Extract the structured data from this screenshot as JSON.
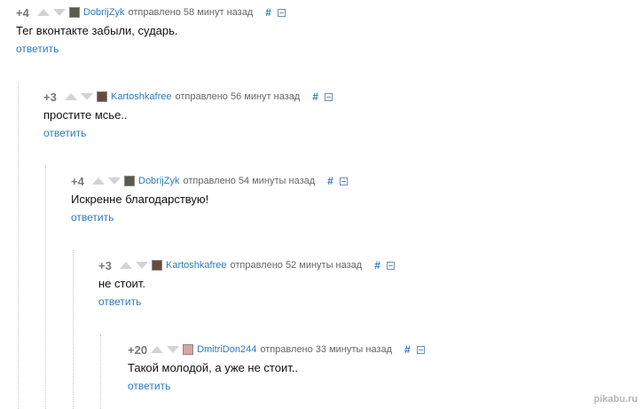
{
  "comments": [
    {
      "rating": "+4",
      "author": "DobrijZyk",
      "sent": "отправлено 58 минут назад",
      "hash": "#",
      "text": "Тег вконтакте забыли, сударь.",
      "reply": "ответить"
    },
    {
      "rating": "+3",
      "author": "Kartoshkafree",
      "sent": "отправлено 56 минут назад",
      "hash": "#",
      "text": "простите мсье..",
      "reply": "ответить"
    },
    {
      "rating": "+4",
      "author": "DobrijZyk",
      "sent": "отправлено 54 минуты назад",
      "hash": "#",
      "text": "Искренне благодарствую!",
      "reply": "ответить"
    },
    {
      "rating": "+3",
      "author": "Kartoshkafree",
      "sent": "отправлено 52 минуты назад",
      "hash": "#",
      "text": "не стоит.",
      "reply": "ответить"
    },
    {
      "rating": "+20",
      "author": "DmitriDon244",
      "sent": "отправлено 33 минуты назад",
      "hash": "#",
      "text": "Такой молодой, а уже не стоит..",
      "reply": "ответить"
    }
  ],
  "watermark": "pikabu.ru",
  "colors": {
    "link": "#2a7bc2",
    "meta": "#666666",
    "rating": "#777777"
  }
}
